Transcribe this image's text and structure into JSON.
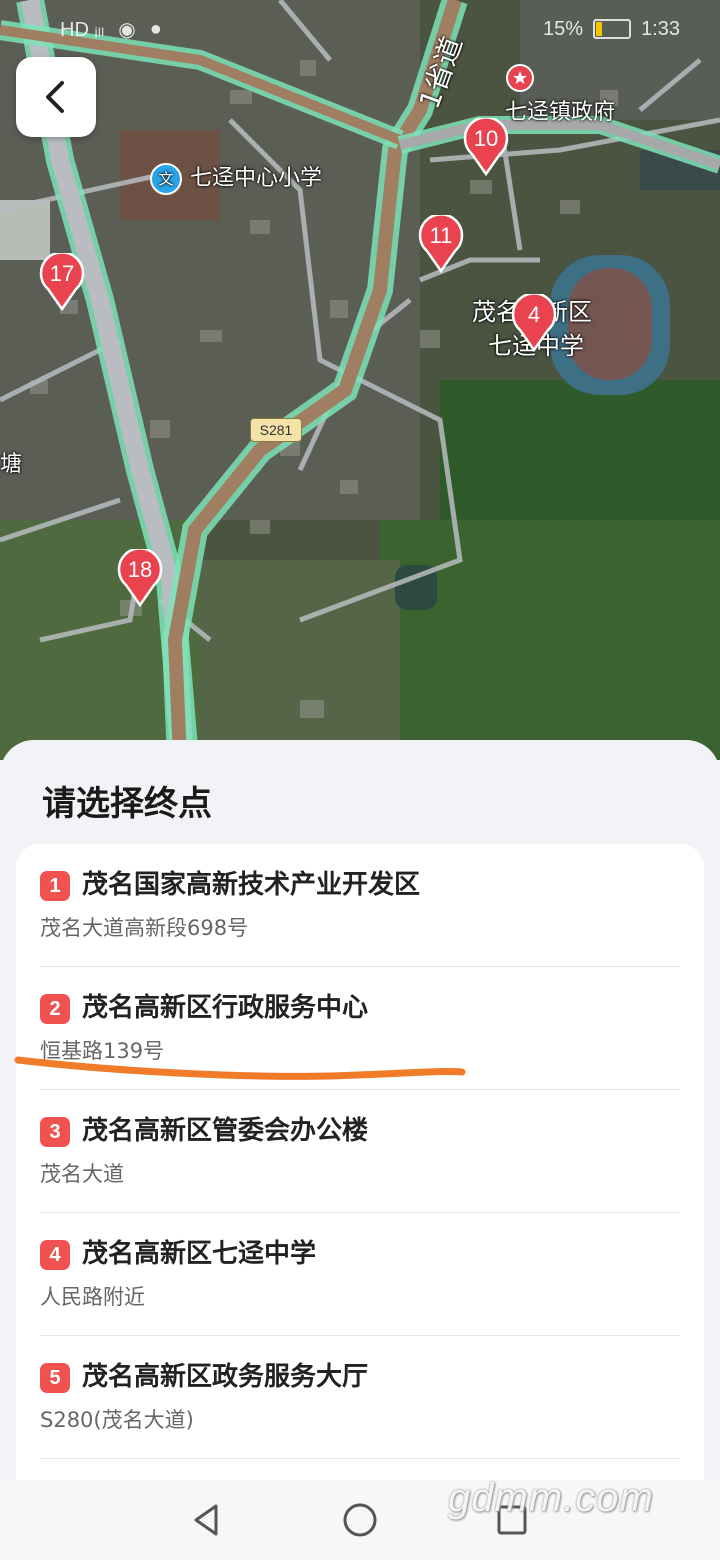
{
  "status_bar": {
    "left": "HD ᵢₗₗ",
    "battery": "15%",
    "time": "1:33"
  },
  "map": {
    "labels": {
      "road_provincial": "1省道",
      "gov": "七迳镇政府",
      "primary_school": "七迳中心小学",
      "middle_school_line1": "茂名高新区",
      "middle_school_line2": "七迳中学",
      "village_edge": "塘",
      "road_shield": "S281"
    },
    "pins": [
      "10",
      "11",
      "17",
      "4",
      "18"
    ],
    "school_icon_text": "文"
  },
  "sheet": {
    "title": "请选择终点",
    "items": [
      {
        "num": "1",
        "name": "茂名国家高新技术产业开发区",
        "addr": "茂名大道高新段698号"
      },
      {
        "num": "2",
        "name": "茂名高新区行政服务中心",
        "addr": "恒基路139号"
      },
      {
        "num": "3",
        "name": "茂名高新区管委会办公楼",
        "addr": "茂名大道"
      },
      {
        "num": "4",
        "name": "茂名高新区七迳中学",
        "addr": "人民路附近"
      },
      {
        "num": "5",
        "name": "茂名高新区政务服务大厅",
        "addr": "S280(茂名大道)"
      }
    ]
  },
  "watermark": "gdmm.com",
  "colors": {
    "pin": "#e8434f",
    "badge": "#f0524f",
    "annotation": "#f07c2a"
  }
}
